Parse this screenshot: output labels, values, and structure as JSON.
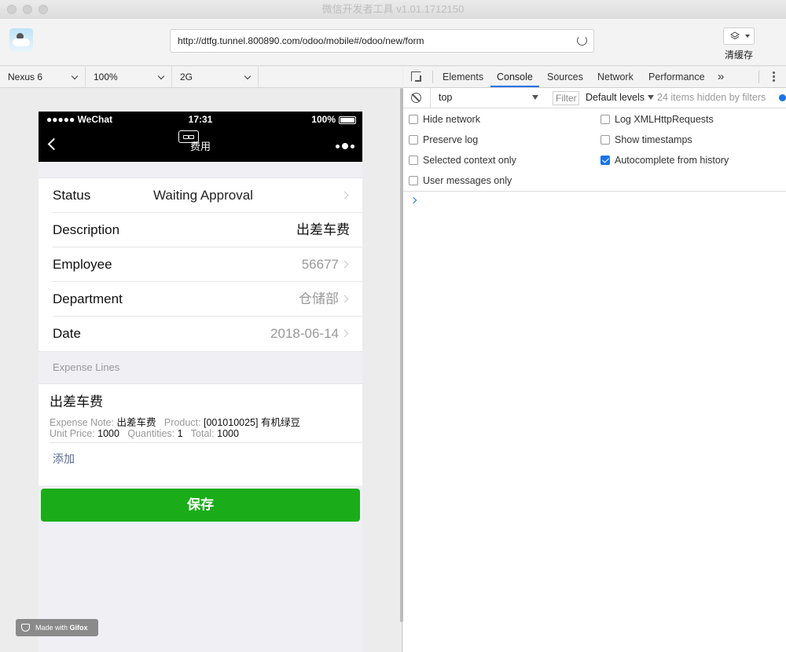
{
  "window": {
    "title": "微信开发者工具 v1.01.1712150"
  },
  "toolbar": {
    "url": "http://dtfg.tunnel.800890.com/odoo/mobile#/odoo/new/form",
    "clear_cache_label": "清缓存"
  },
  "device_bar": {
    "device": "Nexus 6",
    "zoom": "100%",
    "network": "2G"
  },
  "phone": {
    "status": {
      "carrier": "●●●●● WeChat",
      "time": "17:31",
      "battery": "100%"
    },
    "nav": {
      "title": "费用"
    },
    "fields": [
      {
        "label": "Status",
        "value": "Waiting Approval"
      },
      {
        "label": "Description",
        "value": "出差车费"
      },
      {
        "label": "Employee",
        "value": "56677"
      },
      {
        "label": "Department",
        "value": "仓储部"
      },
      {
        "label": "Date",
        "value": "2018-06-14"
      }
    ],
    "expense_lines": {
      "section_title": "Expense Lines",
      "line_title": "出差车费",
      "note_label": "Expense Note:",
      "note_value": "出差车费",
      "product_label": "Product:",
      "product_value": "[001010025] 有机绿豆",
      "unit_price_label": "Unit Price:",
      "unit_price_value": "1000",
      "quantities_label": "Quantities:",
      "quantities_value": "1",
      "total_label": "Total:",
      "total_value": "1000",
      "add_label": "添加"
    },
    "save_label": "保存"
  },
  "watermark": {
    "prefix": "Made with",
    "brand": "Gifox"
  },
  "devtools": {
    "tabs": [
      "Elements",
      "Console",
      "Sources",
      "Network",
      "Performance"
    ],
    "active_tab": "Console",
    "more_tabs": "»",
    "context": "top",
    "filter_placeholder": "Filter",
    "levels": "Default levels",
    "hidden_note": "24 items hidden by filters",
    "options": [
      {
        "label": "Hide network",
        "checked": false
      },
      {
        "label": "Log XMLHttpRequests",
        "checked": false
      },
      {
        "label": "Preserve log",
        "checked": false
      },
      {
        "label": "Show timestamps",
        "checked": false
      },
      {
        "label": "Selected context only",
        "checked": false
      },
      {
        "label": "Autocomplete from history",
        "checked": true
      },
      {
        "label": "User messages only",
        "checked": false
      }
    ]
  },
  "colors": {
    "wechat_green": "#1aad19",
    "devtools_blue": "#1a73e8",
    "link_blue": "#576b95"
  }
}
